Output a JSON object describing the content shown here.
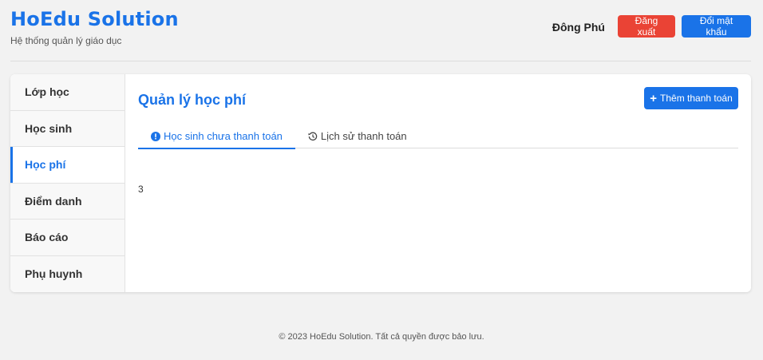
{
  "header": {
    "title": "HoEdu Solution",
    "subtitle": "Hệ thống quản lý giáo dục",
    "user_name": "Đông Phú",
    "logout_label": "Đăng xuất",
    "change_password_label": "Đổi mật khẩu"
  },
  "sidebar": {
    "items": [
      {
        "label": "Lớp học"
      },
      {
        "label": "Học sinh"
      },
      {
        "label": "Học phí"
      },
      {
        "label": "Điểm danh"
      },
      {
        "label": "Báo cáo"
      },
      {
        "label": "Phụ huynh"
      }
    ],
    "active_index": 2
  },
  "main": {
    "title": "Quản lý học phí",
    "add_button_label": "Thêm thanh toán",
    "tabs": [
      {
        "label": "Học sinh chưa thanh toán",
        "icon": "info-circle-icon"
      },
      {
        "label": "Lịch sử thanh toán",
        "icon": "history-icon"
      }
    ],
    "active_tab": 0,
    "content_value": "3"
  },
  "footer": {
    "text": "© 2023 HoEdu Solution. Tất cả quyền được bảo lưu."
  },
  "colors": {
    "primary": "#1a73e8",
    "danger": "#ea4335"
  }
}
